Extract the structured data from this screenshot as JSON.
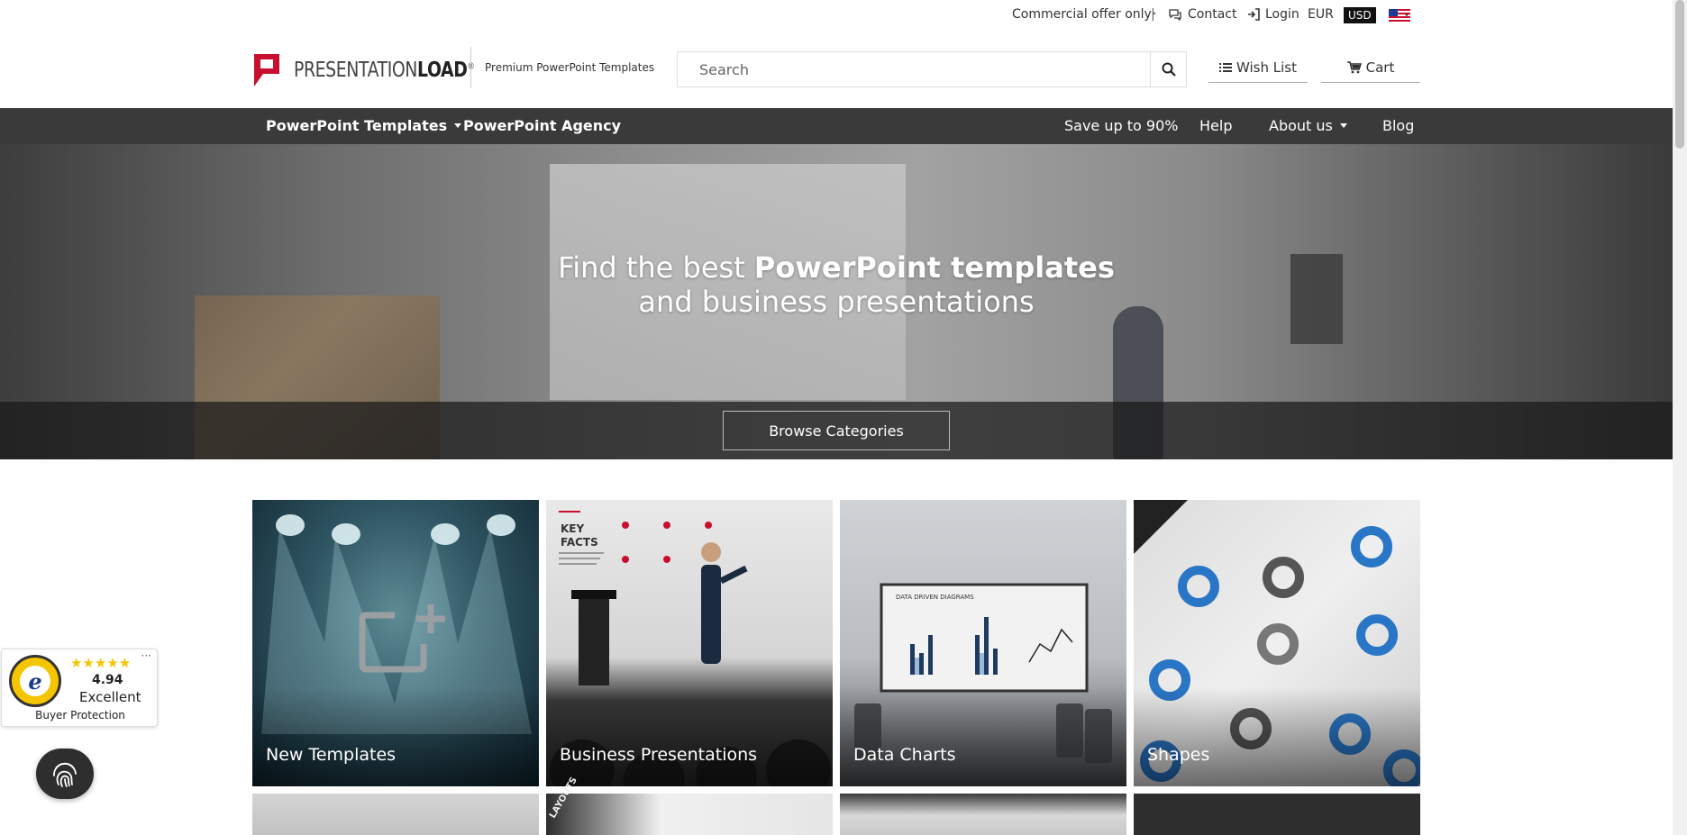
{
  "topbar": {
    "commercial": "Commercial offer only",
    "asterisk": "*",
    "separator": "|",
    "contact": "Contact",
    "login": "Login",
    "eur": "EUR",
    "usd": "USD"
  },
  "header": {
    "logo_light": "PRESENTATION",
    "logo_bold": "LOAD",
    "logo_reg": "®",
    "tagline": "Premium PowerPoint Templates",
    "search_placeholder": "Search",
    "wishlist": "Wish List",
    "cart": "Cart"
  },
  "nav": {
    "templates": "PowerPoint Templates",
    "agency": "PowerPoint Agency",
    "save": "Save up to 90%",
    "help": "Help",
    "about": "About us",
    "blog": "Blog"
  },
  "hero": {
    "line1_light": "Find the best ",
    "line1_bold": "PowerPoint templates",
    "line2": "and business presentations",
    "browse": "Browse Categories"
  },
  "tiles": [
    {
      "label": "New Templates"
    },
    {
      "label": "Business Presentations"
    },
    {
      "label": "Data Charts"
    },
    {
      "label": "Shapes"
    }
  ],
  "tile_art": {
    "key_facts_1": "KEY",
    "key_facts_2": "FACTS",
    "data_driven": "DATA DRIVEN DIAGRAMS",
    "layouts": "LAYOUTS"
  },
  "trusted": {
    "stars": "★★★★★",
    "score": "4.94",
    "rating": "Excellent",
    "protection": "Buyer Protection",
    "seal_letter": "e",
    "more": "···"
  },
  "colors": {
    "nav_bg": "#3a3a3a",
    "logo_red": "#c8102e",
    "star": "#f4c500"
  }
}
